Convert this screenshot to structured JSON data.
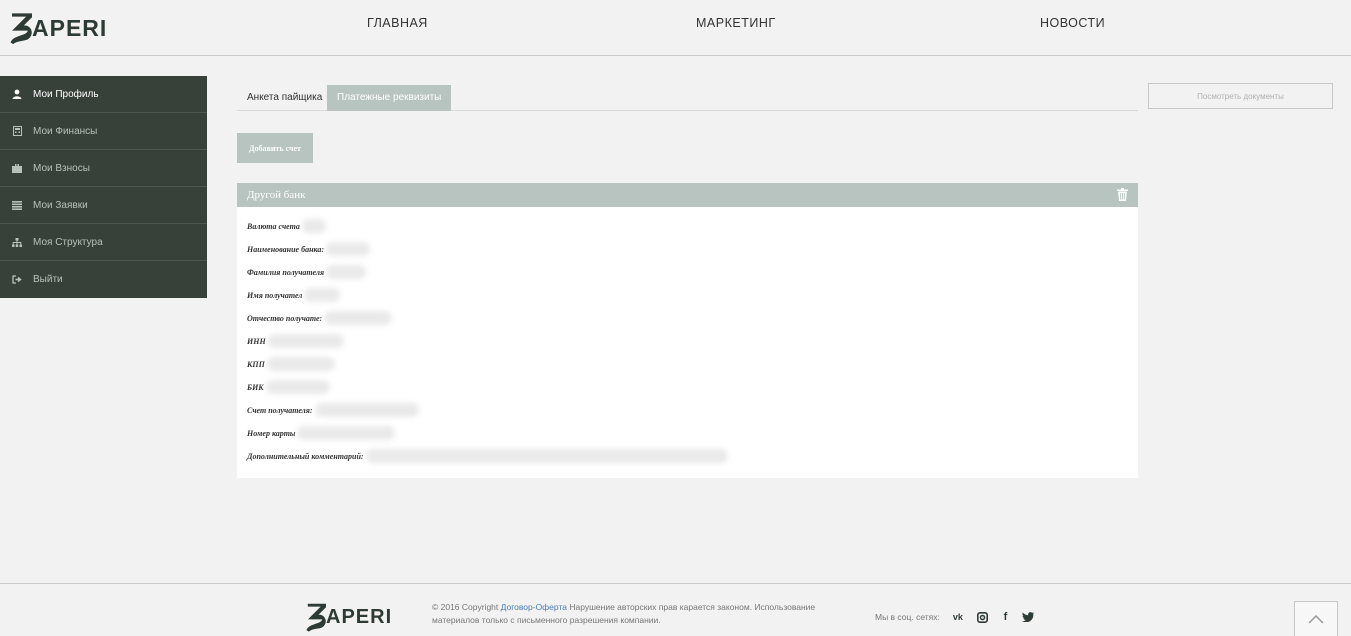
{
  "header": {
    "logo": "ZAPERI",
    "nav": [
      "ГЛАВНАЯ",
      "МАРКЕТИНГ",
      "НОВОСТИ"
    ]
  },
  "sidebar": {
    "items": [
      {
        "label": "Мои Профиль",
        "icon": "user-icon"
      },
      {
        "label": "Мои Финансы",
        "icon": "calculator-icon"
      },
      {
        "label": "Мои Взносы",
        "icon": "briefcase-icon"
      },
      {
        "label": "Мои Заявки",
        "icon": "list-icon"
      },
      {
        "label": "Моя Структура",
        "icon": "sitemap-icon"
      },
      {
        "label": "Выйти",
        "icon": "sign-out-icon"
      }
    ]
  },
  "tabs": [
    "Анкета пайщика",
    "Платежные реквизиты"
  ],
  "docs_button": "Посмотреть документы",
  "add_button": "Добавить счет",
  "panel": {
    "title": "Другой банк",
    "fields": [
      "Валюта счета",
      "Наименование банка:",
      "Фамилия получателя",
      "Имя получател",
      "Отчество получате:",
      "ИНН",
      "КПП",
      "БИК",
      "Счет получателя:",
      "Номер карты",
      "Дополнительный комментарий:"
    ]
  },
  "footer": {
    "logo": "ZAPERI",
    "copyright_prefix": "© 2016 Copyright ",
    "copyright_link": "Договор-Оферта",
    "copyright_suffix": " Нарушение авторских прав карается законом. Использование материалов только с письменного разрешения компании.",
    "social_label": "Мы в соц. сетях:"
  },
  "colors": {
    "sidebar_bg": "#374039",
    "accent": "#b8c4c0",
    "link": "#4a7db5"
  }
}
